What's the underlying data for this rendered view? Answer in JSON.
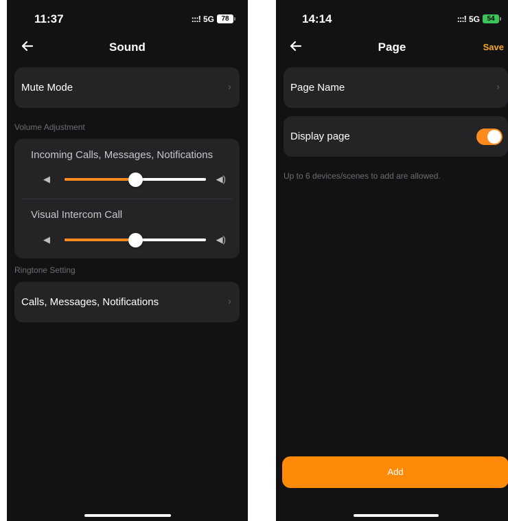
{
  "left_screen": {
    "status": {
      "time": "11:37",
      "signal": ":::!",
      "network": "5G",
      "battery": "78"
    },
    "title": "Sound",
    "mute_mode": {
      "label": "Mute Mode"
    },
    "volume_section": {
      "title": "Volume Adjustment",
      "sliders": [
        {
          "label": "Incoming Calls, Messages, Notifications",
          "value": 0.5
        },
        {
          "label": "Visual Intercom Call",
          "value": 0.5
        }
      ]
    },
    "ringtone_section": {
      "title": "Ringtone Setting",
      "item": {
        "label": "Calls, Messages, Notifications"
      }
    }
  },
  "right_screen": {
    "status": {
      "time": "14:14",
      "signal": ":::!",
      "network": "5G",
      "battery": "54"
    },
    "title": "Page",
    "save_label": "Save",
    "page_name": {
      "label": "Page Name"
    },
    "display_page": {
      "label": "Display page",
      "enabled": true
    },
    "hint": "Up to 6 devices/scenes to add are allowed.",
    "add_button": "Add"
  },
  "colors": {
    "accent": "#ff8a1e",
    "background": "#121214",
    "card": "#242427",
    "save": "#f5a623"
  }
}
